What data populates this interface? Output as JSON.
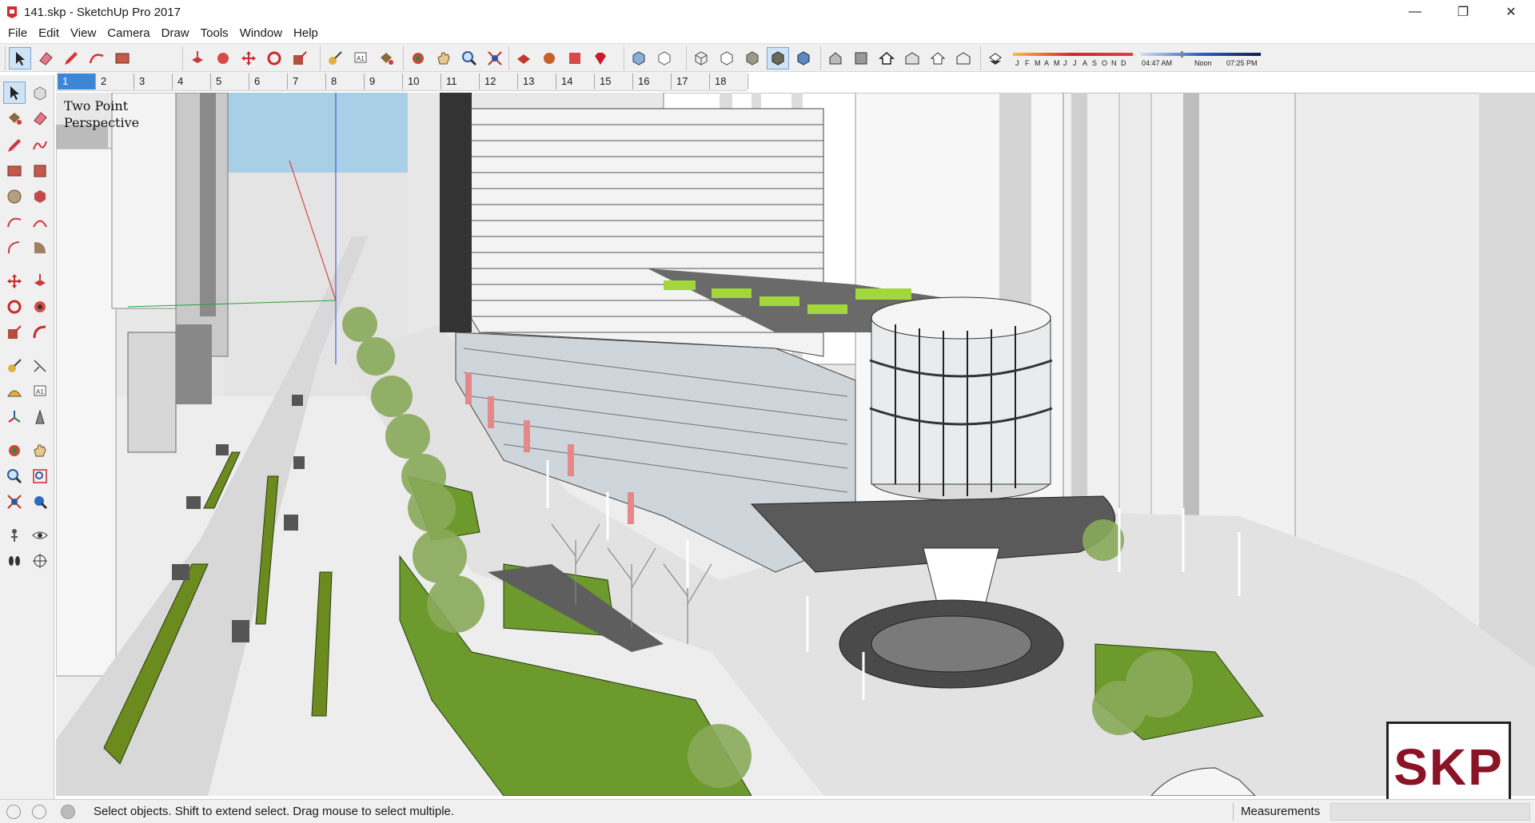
{
  "window": {
    "title": "141.skp - SketchUp Pro 2017",
    "controls": {
      "minimize": "—",
      "maximize": "❐",
      "close": "✕"
    }
  },
  "menu": [
    "File",
    "Edit",
    "View",
    "Camera",
    "Draw",
    "Tools",
    "Window",
    "Help"
  ],
  "toolbar": {
    "shadow_months": [
      "J",
      "F",
      "M",
      "A",
      "M",
      "J",
      "J",
      "A",
      "S",
      "O",
      "N",
      "D"
    ],
    "time_start": "04:47 AM",
    "time_mid": "Noon",
    "time_end": "07:25 PM"
  },
  "scenes": {
    "tabs": [
      "1",
      "2",
      "3",
      "4",
      "5",
      "6",
      "7",
      "8",
      "9",
      "10",
      "11",
      "12",
      "13",
      "14",
      "15",
      "16",
      "17",
      "18"
    ],
    "active": "1"
  },
  "viewport": {
    "view_label_line1": "Two Point",
    "view_label_line2": "Perspective",
    "logo_text": "SKP"
  },
  "status": {
    "message": "Select objects. Shift to extend select. Drag mouse to select multiple.",
    "measurements_label": "Measurements",
    "measurements_value": ""
  },
  "colors": {
    "accent": "#3d86d6",
    "logo": "#8a1326",
    "grass": "#6a9a2a"
  }
}
